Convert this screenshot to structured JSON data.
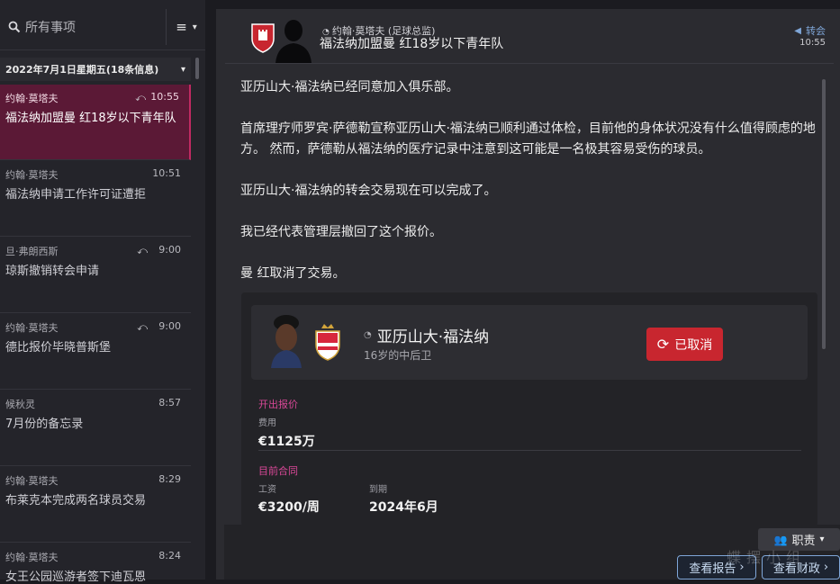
{
  "sidebar": {
    "search_placeholder": "所有事项",
    "day_header": "2022年7月1日星期五(18条信息)",
    "messages": [
      {
        "sender": "约翰·莫塔夫",
        "time": "10:55",
        "subject": "福法纳加盟曼 红18岁以下青年队",
        "replied": true,
        "active": true
      },
      {
        "sender": "约翰·莫塔夫",
        "time": "10:51",
        "subject": "福法纳申请工作许可证遭拒",
        "replied": false,
        "active": false
      },
      {
        "sender": "旦·弗朗西斯",
        "time": "9:00",
        "subject": "琼斯撤销转会申请",
        "replied": true,
        "active": false
      },
      {
        "sender": "约翰·莫塔夫",
        "time": "9:00",
        "subject": "德比报价毕晓普斯堡",
        "replied": true,
        "active": false
      },
      {
        "sender": "候秋灵",
        "time": "8:57",
        "subject": "7月份的备忘录",
        "replied": false,
        "active": false
      },
      {
        "sender": "约翰·莫塔夫",
        "time": "8:29",
        "subject": "布莱克本完成两名球员交易",
        "replied": false,
        "active": false
      },
      {
        "sender": "约翰·莫塔夫",
        "time": "8:24",
        "subject": "女王公园巡游者签下迪瓦恩",
        "replied": false,
        "active": false
      }
    ]
  },
  "header": {
    "sender": "约翰·莫塔夫 (足球总监)",
    "subject": "福法纳加盟曼 红18岁以下青年队",
    "tag": "转会",
    "time": "10:55"
  },
  "body": {
    "paragraphs": [
      "亚历山大·福法纳已经同意加入俱乐部。",
      "首席理疗师罗宾·萨德勒宣称亚历山大·福法纳已顺利通过体检，目前他的身体状况没有什么值得顾虑的地方。 然而，萨德勒从福法纳的医疗记录中注意到这可能是一名极其容易受伤的球员。",
      "亚历山大·福法纳的转会交易现在可以完成了。",
      "我已经代表管理层撤回了这个报价。",
      "曼 红取消了交易。"
    ]
  },
  "card": {
    "player_name": "亚历山大·福法纳",
    "player_desc": "16岁的中后卫",
    "cancel_label": "已取消",
    "offer_title": "开出报价",
    "fee_label": "费用",
    "fee_value": "€1125万",
    "contract_title": "目前合同",
    "wage_label": "工资",
    "wage_value": "€3200/周",
    "expiry_label": "到期",
    "expiry_value": "2024年6月"
  },
  "footer": {
    "duties_label": "职责",
    "view_report_label": "查看报告",
    "view_finance_label": "查看财政",
    "watermark": "蝶摆小组"
  },
  "colors": {
    "accent_pink": "#d94897",
    "active_row": "#5b1936",
    "cancel_red": "#c8262f",
    "link_blue": "#7fa6d8"
  }
}
